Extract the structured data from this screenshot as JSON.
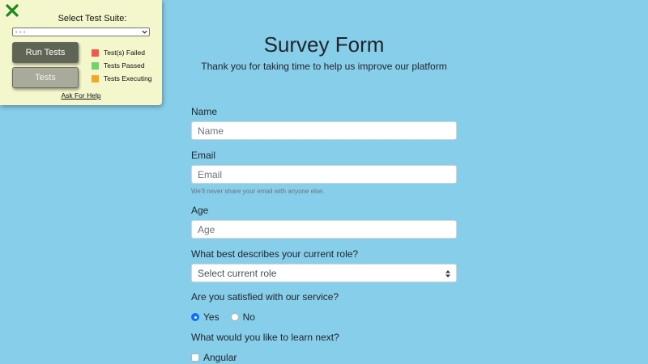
{
  "test_panel": {
    "select_label": "Select Test Suite:",
    "select_value": "- - -",
    "run_button": "Run Tests",
    "tests_button": "Tests",
    "legend": [
      {
        "label": "Test(s) Failed",
        "color": "#f15a4a"
      },
      {
        "label": "Tests Passed",
        "color": "#6cd468"
      },
      {
        "label": "Tests Executing",
        "color": "#f5a623"
      }
    ],
    "help_link": "Ask For Help"
  },
  "survey": {
    "title": "Survey Form",
    "description": "Thank you for taking time to help us improve our platform",
    "name_label": "Name",
    "name_placeholder": "Name",
    "email_label": "Email",
    "email_placeholder": "Email",
    "email_help": "We'll never share your email with anyone else.",
    "age_label": "Age",
    "age_placeholder": "Age",
    "role_label": "What best describes your current role?",
    "role_selected": "Select current role",
    "satisfied_label": "Are you satisfied with our service?",
    "satisfied_options": [
      "Yes",
      "No"
    ],
    "learn_label": "What would you like to learn next?",
    "learn_options": [
      "Angular"
    ]
  },
  "colors": {
    "background": "#87CEEB",
    "panel": "#f4f6cc",
    "close_icon": "#1d8a1d",
    "radio_accent": "#0d6efd"
  },
  "icons": {
    "close": "close-icon",
    "select_chevron": "chevron-down-icon",
    "select_arrows": "sort-arrows-icon"
  }
}
